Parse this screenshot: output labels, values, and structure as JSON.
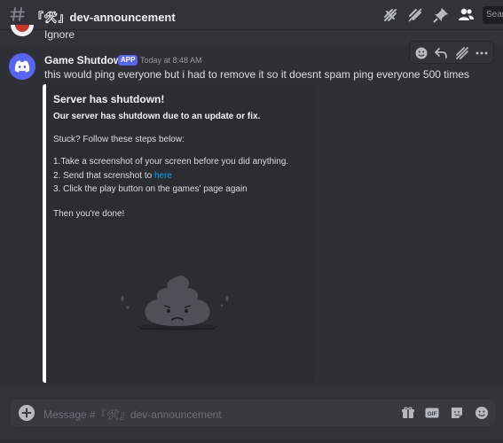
{
  "header": {
    "channel_name": "『🛠』dev-announcement",
    "search_label": "Search"
  },
  "previous_message": {
    "text": "Ignore"
  },
  "message": {
    "author": "Game Shutdown",
    "tag": "APP",
    "timestamp": "Today at 8:48 AM",
    "content": "this would ping everyone but i had to remove it so it doesnt spam ping everyone 500 times",
    "embed": {
      "accent_color": "#ffffff",
      "title": "Server has shutdown!",
      "subtitle": "Our server has shutdown due to an update or fix.",
      "stuck": "Stuck? Follow these steps below:",
      "step1": "1.Take a screenshot of your screen before you did anything.",
      "step2_prefix": "2. Send that screnshot to ",
      "step2_link": "here",
      "step3": "3. Click the play button on the games' page again",
      "done": "Then you're done!"
    }
  },
  "composer": {
    "placeholder": "Message #『🛠』dev-announcement"
  },
  "colors": {
    "background": "#313338",
    "blurple": "#5865f2",
    "link": "#00a8fc"
  }
}
